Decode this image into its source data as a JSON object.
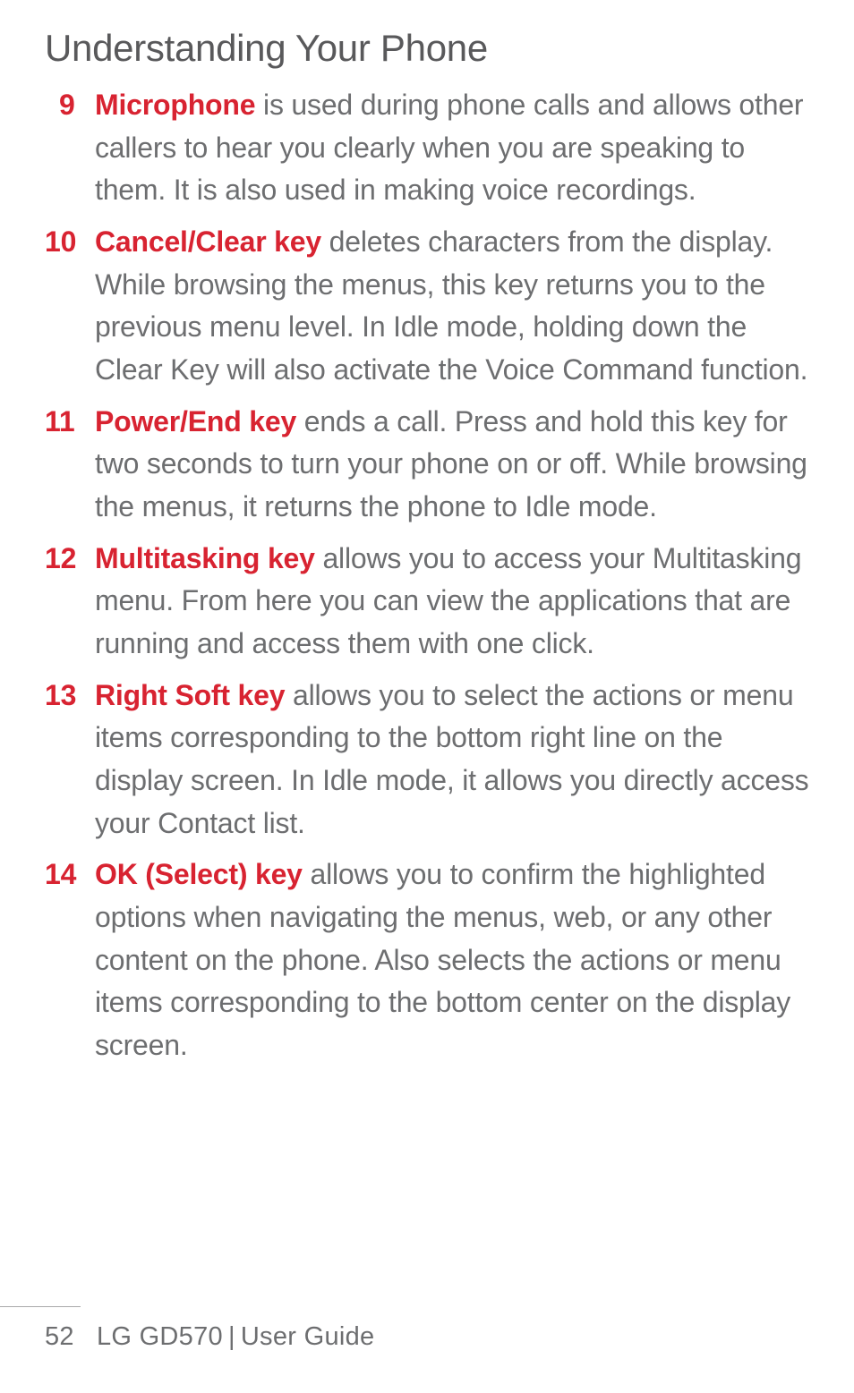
{
  "heading": "Understanding Your Phone",
  "items": [
    {
      "num": "9",
      "term": "Microphone",
      "desc": " is used during phone calls and allows other callers to hear you clearly when you are speaking to them. It is also used in making voice recordings."
    },
    {
      "num": "10",
      "term": "Cancel/Clear key",
      "desc": " deletes characters from the display. While browsing the menus, this key returns you to the previous menu level. In Idle mode, holding down the Clear Key will also activate the Voice Command function."
    },
    {
      "num": "11",
      "term": "Power/End key",
      "desc": " ends a call. Press and hold this key for two seconds to turn your phone on or off. While browsing the menus, it returns the phone to Idle mode."
    },
    {
      "num": "12",
      "term": "Multitasking key",
      "desc": " allows you to access your Multitasking menu. From here you can view the applications that are running and access them with one click."
    },
    {
      "num": "13",
      "term": "Right Soft key",
      "desc": " allows you to select the actions or menu items corresponding to the bottom right line on the display screen. In Idle mode, it allows you directly access your Contact list."
    },
    {
      "num": "14",
      "term": "OK (Select) key",
      "desc": " allows you to confirm the highlighted options when navigating the menus, web, or any other content on the phone. Also selects the actions or menu items corresponding to the bottom center on the display screen."
    }
  ],
  "footer": {
    "page_number": "52",
    "product": "LG GD570",
    "divider": "|",
    "doc_type": "User Guide"
  }
}
